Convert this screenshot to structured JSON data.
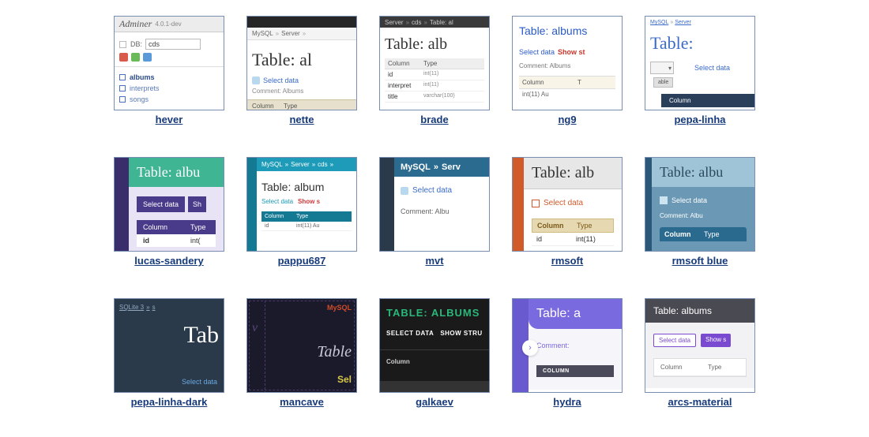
{
  "items": [
    {
      "label": "hever",
      "a": {
        "brand": "Adminer",
        "ver": "4.0.1-dev",
        "db_label": "DB:",
        "db_val": "cds",
        "list": [
          "albums",
          "interprets",
          "songs"
        ]
      }
    },
    {
      "label": "nette",
      "a": {
        "crumb1": "MySQL",
        "crumb2": "Server",
        "title": "Table: al",
        "select": "Select data",
        "comment": "Comment: Albums",
        "col": "Column",
        "type": "Type"
      }
    },
    {
      "label": "brade",
      "a": {
        "crumb1": "Server",
        "crumb2": "cds",
        "crumb3": "Table: al",
        "title": "Table: alb",
        "col": "Column",
        "type": "Type",
        "r1": "id",
        "r1t": "int(11)",
        "r2": "interpret",
        "r2t": "int(11)",
        "r3": "title",
        "r3t": "varchar(100)"
      }
    },
    {
      "label": "ng9",
      "a": {
        "title": "Table: albums",
        "select": "Select data",
        "show": "Show st",
        "comment": "Comment: Albums",
        "col": "Column",
        "type": "T",
        "r1": "int(11) Au"
      }
    },
    {
      "label": "pepa-linha",
      "a": {
        "crumb1": "MySQL",
        "crumb2": "Server",
        "title": "Table:",
        "select": "Select data",
        "btn": "able",
        "bar": "Column"
      }
    },
    {
      "label": "lucas-sandery",
      "a": {
        "title": "Table: albu",
        "select": "Select data",
        "show": "Sh",
        "col": "Column",
        "type": "Type",
        "r1": "id",
        "r1t": "int("
      }
    },
    {
      "label": "pappu687",
      "a": {
        "crumb1": "MySQL",
        "crumb2": "Server",
        "crumb3": "cds",
        "title": "Table: album",
        "select": "Select data",
        "show": "Show s",
        "col": "Column",
        "type": "Type",
        "r1": "id",
        "r1t": "int(11) Au"
      }
    },
    {
      "label": "mvt",
      "a": {
        "crumb1": "MySQL",
        "crumb2": "Serv",
        "select": "Select data",
        "comment": "Comment: Albu"
      }
    },
    {
      "label": "rmsoft",
      "a": {
        "title": "Table: alb",
        "select": "Select data",
        "col": "Column",
        "type": "Type",
        "r1": "id",
        "r1t": "int(11)"
      }
    },
    {
      "label": "rmsoft blue",
      "a": {
        "title": "Table: albu",
        "select": "Select data",
        "comment": "Comment: Albu",
        "col": "Column",
        "type": "Type"
      }
    },
    {
      "label": "pepa-linha-dark",
      "a": {
        "crumb1": "SQLite 3",
        "crumb2": "s",
        "title": "Tab",
        "select": "Select data"
      }
    },
    {
      "label": "mancave",
      "a": {
        "crumb": "MySQL",
        "lv": "v",
        "title": "Table",
        "sel": "Sel"
      }
    },
    {
      "label": "galkaev",
      "a": {
        "title": "TABLE: ALBUMS",
        "select": "SELECT DATA",
        "show": "SHOW STRU",
        "col": "Column",
        "bar": "COLUMN"
      }
    },
    {
      "label": "hydra",
      "a": {
        "title": "Table: a",
        "comment": "Comment:",
        "col": "COLUMN"
      }
    },
    {
      "label": "arcs-material",
      "a": {
        "title": "Table: albums",
        "select": "Select data",
        "show": "Show s",
        "col": "Column",
        "type": "Type"
      }
    }
  ]
}
